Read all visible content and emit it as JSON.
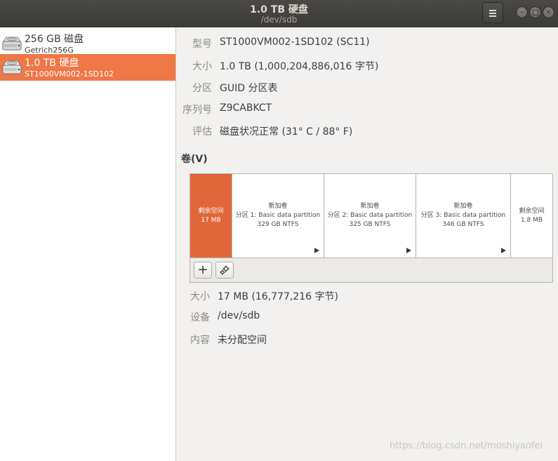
{
  "window": {
    "title": "1.0 TB 硬盘",
    "subtitle": "/dev/sdb",
    "controls": [
      "minimize",
      "maximize",
      "close"
    ]
  },
  "sidebar": {
    "items": [
      {
        "name": "256 GB 磁盘",
        "model": "Getrich256G",
        "selected": false
      },
      {
        "name": "1.0 TB 硬盘",
        "model": "ST1000VM002-1SD102",
        "selected": true
      }
    ]
  },
  "drive_info": {
    "model_label": "型号",
    "model_value": "ST1000VM002-1SD102 (SC11)",
    "size_label": "大小",
    "size_value": "1.0 TB (1,000,204,886,016 字节)",
    "partitioning_label": "分区",
    "partitioning_value": "GUID 分区表",
    "serial_label": "序列号",
    "serial_value": "Z9CABKCT",
    "assessment_label": "评估",
    "assessment_value": "磁盘状况正常 (31° C / 88° F)"
  },
  "volumes": {
    "heading": "卷(V)",
    "segments": [
      {
        "line1": "剩余空间",
        "line2": "17 MB",
        "line3": "",
        "selected": true
      },
      {
        "line1": "新加卷",
        "line2": "分区 1:  Basic data partition",
        "line3": "329 GB NTFS",
        "selected": false
      },
      {
        "line1": "新加卷",
        "line2": "分区 2:  Basic data partition",
        "line3": "325 GB NTFS",
        "selected": false
      },
      {
        "line1": "新加卷",
        "line2": "分区 3:  Basic data partition",
        "line3": "346 GB NTFS",
        "selected": false
      },
      {
        "line1": "剩余空间",
        "line2": "1.8 MB",
        "line3": "",
        "selected": false
      }
    ],
    "add_label": "+"
  },
  "selection_info": {
    "size_label": "大小",
    "size_value": "17 MB (16,777,216 字节)",
    "device_label": "设备",
    "device_value": "/dev/sdb",
    "contents_label": "内容",
    "contents_value": "未分配空间"
  },
  "watermark": "https://blog.csdn.net/moshiyaofei",
  "colors": {
    "accent": "#f07746",
    "selected_segment": "#e0673a",
    "titlebar": "#3c3b37"
  }
}
